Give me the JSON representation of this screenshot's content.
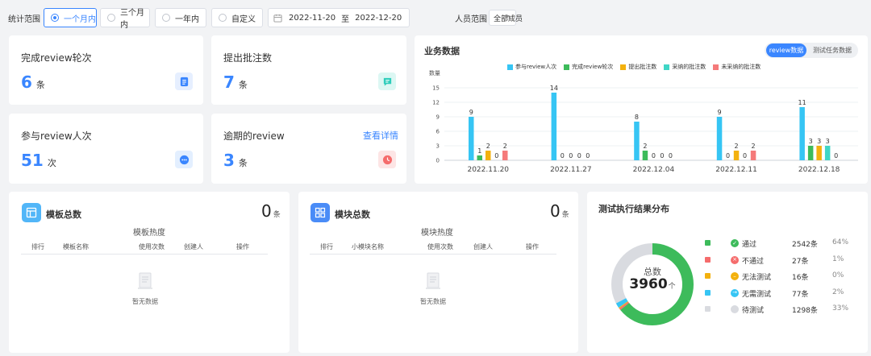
{
  "filter": {
    "period_label": "统计范围",
    "options": [
      "一个月内",
      "三个月内",
      "一年内",
      "自定义"
    ],
    "selected_index": 0,
    "date_start": "2022-11-20",
    "date_separator": "至",
    "date_end": "2022-12-20",
    "member_label": "人员范围",
    "member_value": "全部成员"
  },
  "stats": {
    "review_rounds": {
      "title": "完成review轮次",
      "value": "6",
      "unit": "条"
    },
    "annotations": {
      "title": "提出批注数",
      "value": "7",
      "unit": "条"
    },
    "participants": {
      "title": "参与review人次",
      "value": "51",
      "unit": "次"
    },
    "overdue": {
      "title": "逾期的review",
      "value": "3",
      "unit": "条",
      "link": "查看详情"
    }
  },
  "business": {
    "title": "业务数据",
    "toggle_on": "review数据",
    "toggle_off": "测试任务数据",
    "y_axis_label": "数量",
    "y_ticks": [
      "15",
      "12",
      "9",
      "6",
      "3",
      "0"
    ]
  },
  "chart_data": {
    "type": "bar",
    "title": "业务数据",
    "ylabel": "数量",
    "ylim": [
      0,
      15
    ],
    "categories": [
      "2022.11.20",
      "2022.11.27",
      "2022.12.04",
      "2022.12.11",
      "2022.12.18"
    ],
    "series": [
      {
        "name": "参与review人次",
        "color": "#36c5f4",
        "values": [
          9,
          14,
          8,
          9,
          11
        ]
      },
      {
        "name": "完成review轮次",
        "color": "#3dbb5b",
        "values": [
          1,
          0,
          2,
          0,
          3
        ]
      },
      {
        "name": "提出批注数",
        "color": "#f3b10e",
        "values": [
          2,
          0,
          0,
          2,
          3
        ]
      },
      {
        "name": "采纳的批注数",
        "color": "#3fd6c6",
        "values": [
          0,
          0,
          0,
          0,
          3
        ]
      },
      {
        "name": "未采纳的批注数",
        "color": "#f57a7a",
        "values": [
          2,
          0,
          0,
          2,
          0
        ]
      }
    ],
    "grid": true,
    "legend_position": "top-center"
  },
  "templates": {
    "title": "模板总数",
    "count": "0",
    "unit": "条",
    "subtitle": "模板热度",
    "columns": [
      "排行",
      "模板名称",
      "使用次数",
      "创建人",
      "操作"
    ],
    "empty": "暂无数据"
  },
  "modules": {
    "title": "模块总数",
    "count": "0",
    "unit": "条",
    "subtitle": "模块热度",
    "columns": [
      "排行",
      "小模块名称",
      "使用次数",
      "创建人",
      "操作"
    ],
    "empty": "暂无数据"
  },
  "distribution": {
    "title": "测试执行结果分布",
    "center_label": "总数",
    "total": "3960",
    "total_unit": "个",
    "items": [
      {
        "label": "通过",
        "count": "2542条",
        "pct": "64%",
        "value": 2542,
        "color": "#3dbb5b",
        "icon": "check-icon"
      },
      {
        "label": "不通过",
        "count": "27条",
        "pct": "1%",
        "value": 27,
        "color": "#f56c6c",
        "icon": "cross-icon"
      },
      {
        "label": "无法测试",
        "count": "16条",
        "pct": "0%",
        "value": 16,
        "color": "#f3b10e",
        "icon": "minus-icon"
      },
      {
        "label": "无需测试",
        "count": "77条",
        "pct": "2%",
        "value": 77,
        "color": "#36c5f4",
        "icon": "arrow-icon"
      },
      {
        "label": "待测试",
        "count": "1298条",
        "pct": "33%",
        "value": 1298,
        "color": "#d9dbe0",
        "icon": "dot-icon"
      }
    ]
  }
}
